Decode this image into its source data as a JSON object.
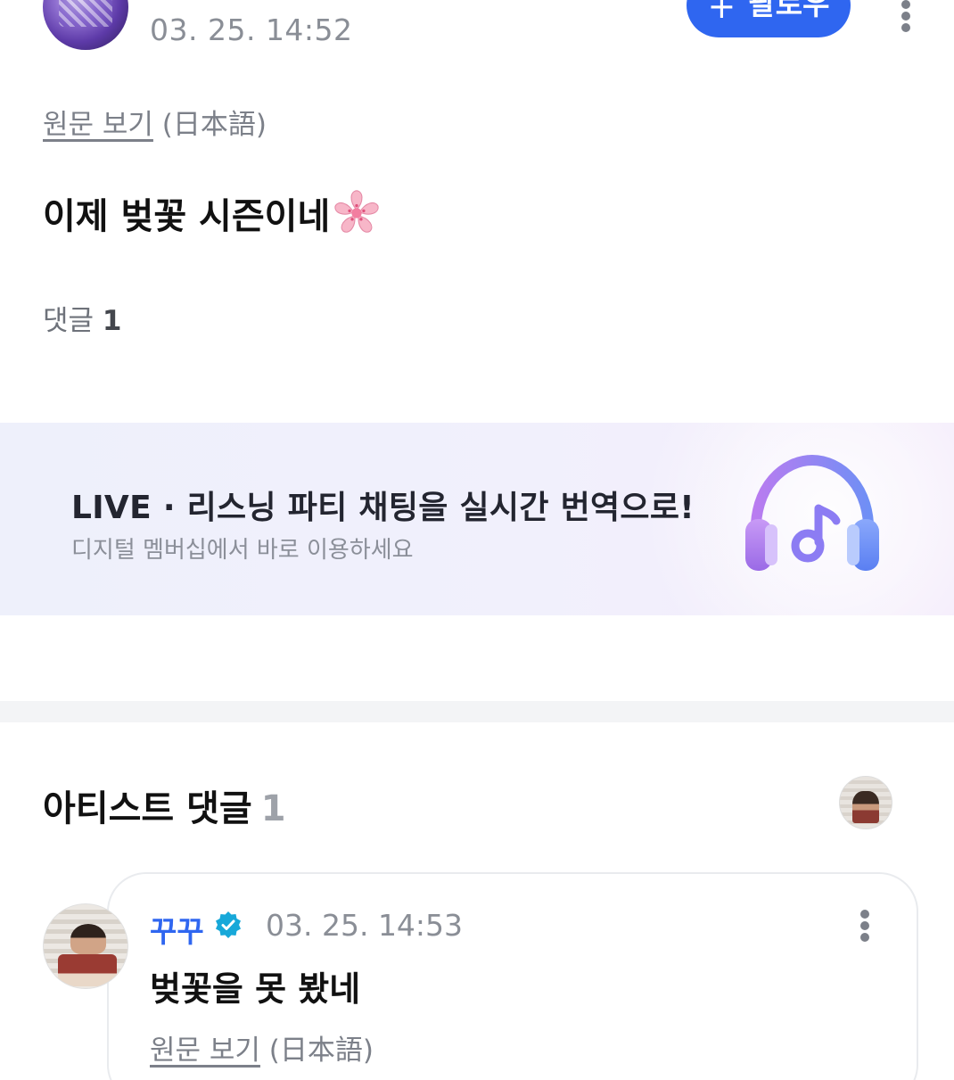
{
  "post": {
    "time": "03. 25. 14:52",
    "follow_plus": "+",
    "follow_label": "팔로우",
    "translate_link": "원문 보기",
    "translate_lang": "(日本語)",
    "text": "이제 벚꽃 시즌이네",
    "emoji_icon": "cherry-blossom-icon",
    "comments_label": "댓글",
    "comments_count": "1"
  },
  "banner": {
    "title": "LIVE · 리스닝 파티 채팅을 실시간 번역으로!",
    "subtitle": "디지털 멤버십에서 바로 이용하세요",
    "icon": "headphones-music-icon"
  },
  "artist_comments": {
    "title": "아티스트 댓글",
    "count": "1",
    "comment": {
      "name": "꾸꾸",
      "time": "03. 25. 14:53",
      "text": "벚꽃을 못 봤네",
      "translate_link": "원문 보기",
      "translate_lang": "(日本語)"
    }
  },
  "colors": {
    "accent": "#2f66f0",
    "verified": "#17a8d9",
    "muted_text": "#8a8e96"
  }
}
